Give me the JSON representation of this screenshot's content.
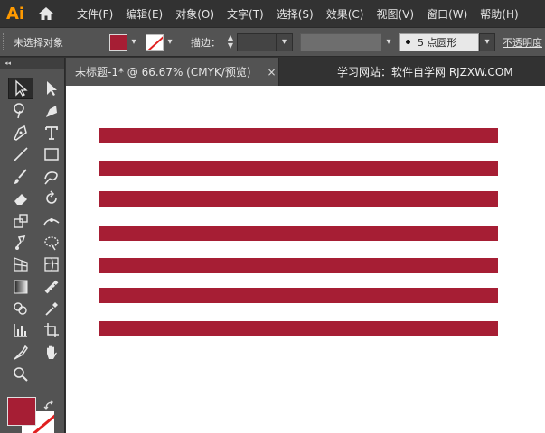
{
  "app": {
    "logo": "Ai"
  },
  "menu": [
    "文件(F)",
    "编辑(E)",
    "对象(O)",
    "文字(T)",
    "选择(S)",
    "效果(C)",
    "视图(V)",
    "窗口(W)",
    "帮助(H)"
  ],
  "control": {
    "selection": "未选择对象",
    "stroke_label": "描边：",
    "brush": "5 点圆形",
    "opacity": "不透明度"
  },
  "toolbar": {
    "collapse": "◂◂"
  },
  "document": {
    "tab_title": "未标题-1* @ 66.67% (CMYK/预览)",
    "tab_close": "×",
    "watermark": "学习网站：软件自学网  RJZXW.COM"
  },
  "colors": {
    "fill": "#a61e34",
    "stroke_none": "#e02020",
    "accent_logo": "#ff9a00"
  },
  "artwork": {
    "shape": "rectangle",
    "stripe_count": 7,
    "fill": "#a61e34"
  }
}
